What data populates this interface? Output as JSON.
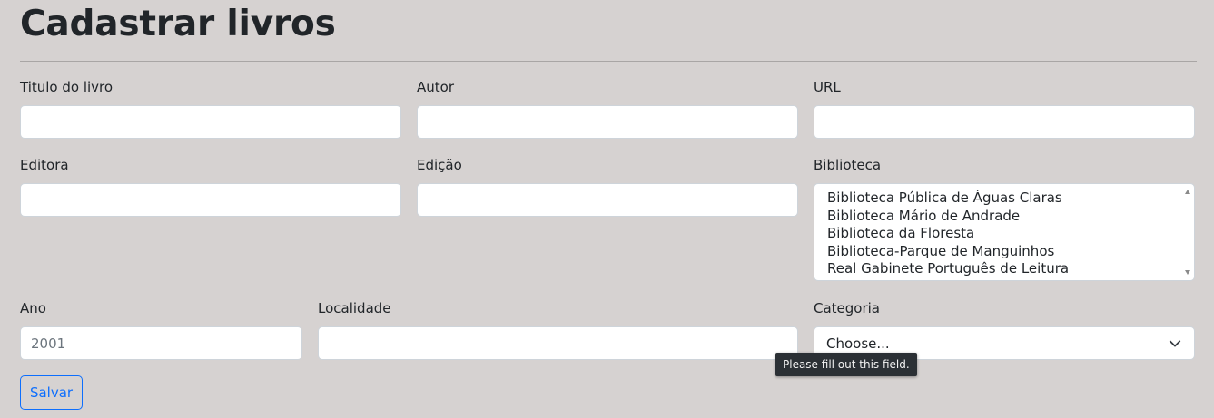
{
  "page": {
    "title": "Cadastrar livros"
  },
  "form": {
    "titulo": {
      "label": "Titulo do livro",
      "value": ""
    },
    "autor": {
      "label": "Autor",
      "value": ""
    },
    "url": {
      "label": "URL",
      "value": ""
    },
    "editora": {
      "label": "Editora",
      "value": ""
    },
    "edicao": {
      "label": "Edição",
      "value": ""
    },
    "biblioteca": {
      "label": "Biblioteca",
      "options": [
        "Biblioteca Pública de Águas Claras",
        "Biblioteca Mário de Andrade",
        "Biblioteca da Floresta",
        "Biblioteca-Parque de Manguinhos",
        "Real Gabinete Português de Leitura"
      ]
    },
    "ano": {
      "label": "Ano",
      "value": "",
      "placeholder": "2001"
    },
    "localidade": {
      "label": "Localidade",
      "value": ""
    },
    "categoria": {
      "label": "Categoria",
      "selected": "Choose..."
    },
    "submit_label": "Salvar"
  },
  "validation_tooltip": "Please fill out this field.",
  "colors": {
    "background": "#d6d2d1",
    "accent": "#0d6efd",
    "tooltip_bg": "#2b3035"
  },
  "icons": {
    "select_arrow": "chevron-down-icon"
  }
}
